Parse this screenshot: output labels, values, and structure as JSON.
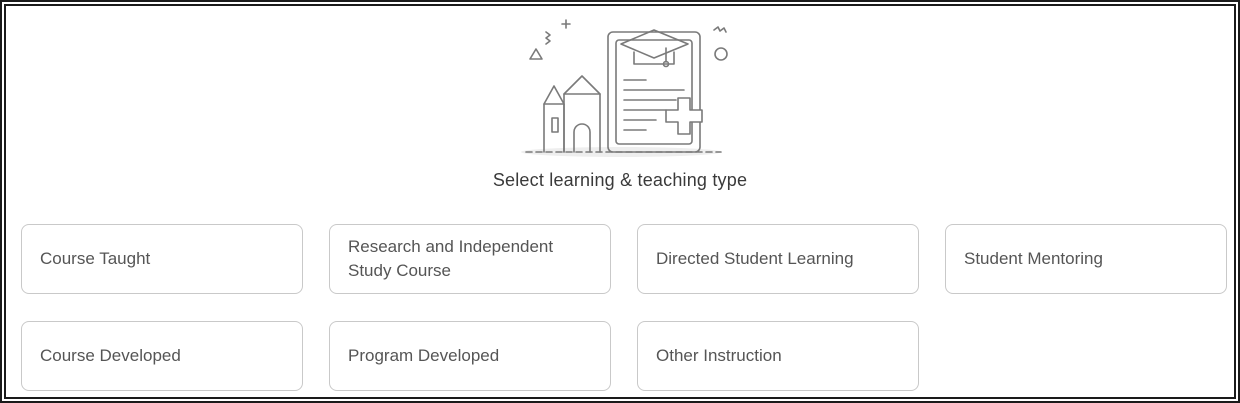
{
  "heading": "Select learning & teaching type",
  "illustration_icon": "education-document-icon",
  "colors": {
    "border": "#c9c9c9",
    "text": "#555555",
    "heading": "#3a3a3a",
    "line": "#7a7a7a"
  },
  "options": [
    {
      "label": "Course Taught"
    },
    {
      "label": "Research and Independent Study Course"
    },
    {
      "label": "Directed Student Learning"
    },
    {
      "label": "Student Mentoring"
    },
    {
      "label": "Course Developed"
    },
    {
      "label": "Program Developed"
    },
    {
      "label": "Other Instruction"
    }
  ]
}
